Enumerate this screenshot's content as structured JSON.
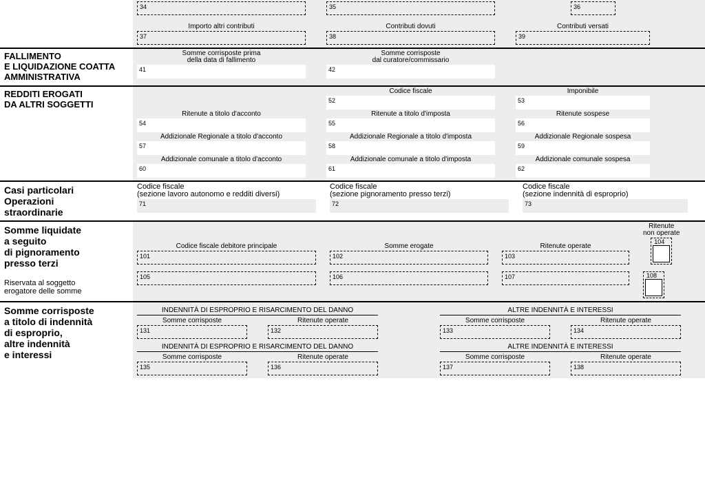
{
  "top": {
    "f34": "34",
    "f35": "35",
    "f36": "36",
    "h37": "Importo altri contributi",
    "h38": "Contributi dovuti",
    "h39": "Contributi versati",
    "f37": "37",
    "f38": "38",
    "f39": "39"
  },
  "fallimento": {
    "title": "FALLIMENTO\nE LIQUIDAZIONE COATTA\nAMMINISTRATIVA",
    "h41": "Somme corrisposte prima\ndella data di fallimento",
    "h42": "Somme corrisposte\ndal curatore/commissario",
    "f41": "41",
    "f42": "42"
  },
  "redditi": {
    "title": "REDDITI EROGATI\nDA ALTRI SOGGETTI",
    "h52": "Codice fiscale",
    "h53": "Imponibile",
    "f52": "52",
    "f53": "53",
    "h54": "Ritenute a titolo d'acconto",
    "h55": "Ritenute a titolo d'imposta",
    "h56": "Ritenute sospese",
    "f54": "54",
    "f55": "55",
    "f56": "56",
    "h57": "Addizionale Regionale a titolo d'acconto",
    "h58": "Addizionale Regionale a titolo d'imposta",
    "h59": "Addizionale Regionale sospesa",
    "f57": "57",
    "f58": "58",
    "f59": "59",
    "h60": "Addizionale comunale a titolo d'acconto",
    "h61": "Addizionale comunale a titolo d'imposta",
    "h62": "Addizionale comunale sospesa",
    "f60": "60",
    "f61": "61",
    "f62": "62"
  },
  "casi": {
    "title": "Casi particolari\nOperazioni\nstraordinarie",
    "h71": "Codice fiscale\n(sezione lavoro autonomo e redditi diversi)",
    "f71": "71",
    "h72": "Codice fiscale\n(sezione pignoramento presso terzi)",
    "f72": "72",
    "h73": "Codice fiscale\n(sezione indennità di esproprio)",
    "f73": "73"
  },
  "somme_pign": {
    "title": "Somme liquidate\na seguito\ndi pignoramento\npresso terzi",
    "sub": "Riservata al soggetto\nerogatore delle somme",
    "h101": "Codice fiscale debitore principale",
    "h102": "Somme erogate",
    "h103": "Ritenute operate",
    "h104": "Ritenute\nnon operate",
    "f101": "101",
    "f102": "102",
    "f103": "103",
    "f104": "104",
    "f105": "105",
    "f106": "106",
    "f107": "107",
    "f108": "108"
  },
  "esproprio": {
    "title": "Somme corrisposte\na titolo di indennità\ndi esproprio,\naltre indennità\ne interessi",
    "g1": "INDENNITÀ DI ESPROPRIO E RISARCIMENTO DEL DANNO",
    "g2": "ALTRE INDENNITÀ E INTERESSI",
    "hs": "Somme corrisposte",
    "hr": "Ritenute operate",
    "f131": "131",
    "f132": "132",
    "f133": "133",
    "f134": "134",
    "f135": "135",
    "f136": "136",
    "f137": "137",
    "f138": "138"
  }
}
